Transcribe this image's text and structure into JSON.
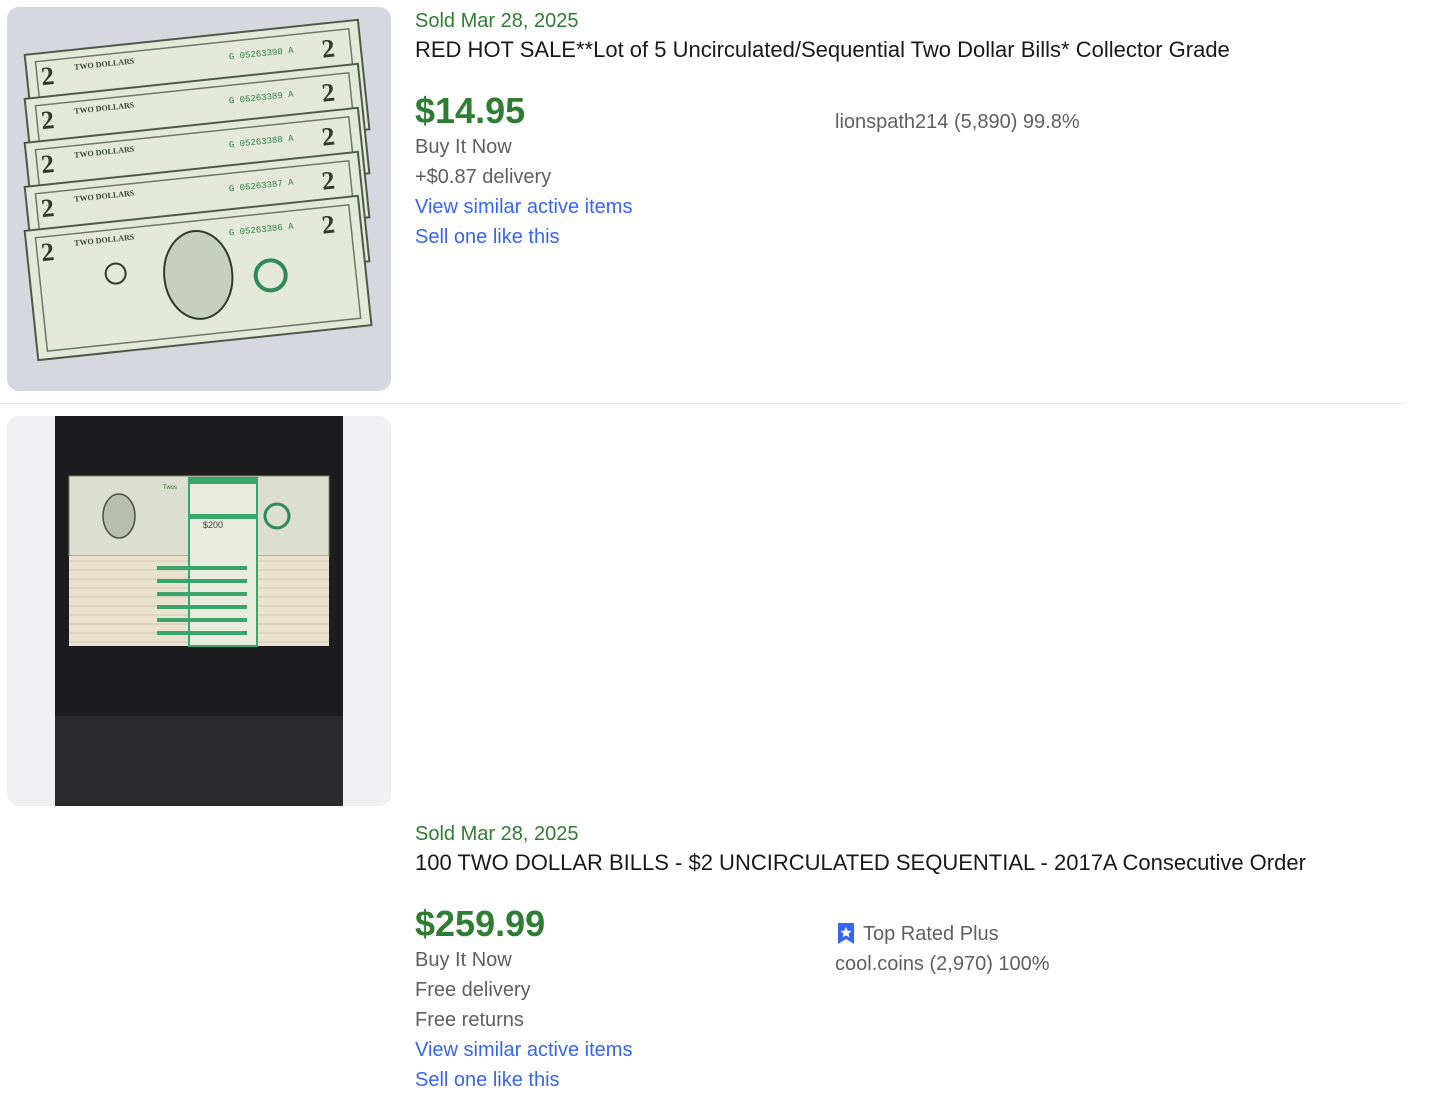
{
  "listings": [
    {
      "sold": "Sold Mar 28, 2025",
      "title": "RED HOT SALE**Lot of 5 Uncirculated/Sequential Two Dollar Bills* Collector Grade",
      "price": "$14.95",
      "format": "Buy It Now",
      "delivery": "+$0.87 delivery",
      "view_similar": "View similar active items",
      "sell_one": "Sell one like this",
      "seller": "lionspath214 (5,890) 99.8%",
      "bill_serials": [
        "G 05263390 A",
        "G 05263389 A",
        "G 05263388 A",
        "G 05263387 A",
        "G 05263386 A"
      ],
      "bill_label": "TWO DOLLARS",
      "bill_denomination": "2"
    },
    {
      "sold": "Sold Mar 28, 2025",
      "title": "100 TWO DOLLAR BILLS - $2 UNCIRCULATED SEQUENTIAL - 2017A Consecutive Order",
      "price": "$259.99",
      "format": "Buy It Now",
      "delivery": "Free delivery",
      "returns": "Free returns",
      "view_similar": "View similar active items",
      "sell_one": "Sell one like this",
      "badge": "Top Rated Plus",
      "seller": "cool.coins (2,970) 100%",
      "strap_label": "$200",
      "strap_word": "Twos"
    }
  ],
  "colors": {
    "sold_green": "#2e7d32",
    "link_blue": "#3665f3",
    "muted": "#5f5f5f",
    "badge_blue": "#3665f3"
  },
  "icons": {
    "badge": "top-rated-plus-icon"
  }
}
